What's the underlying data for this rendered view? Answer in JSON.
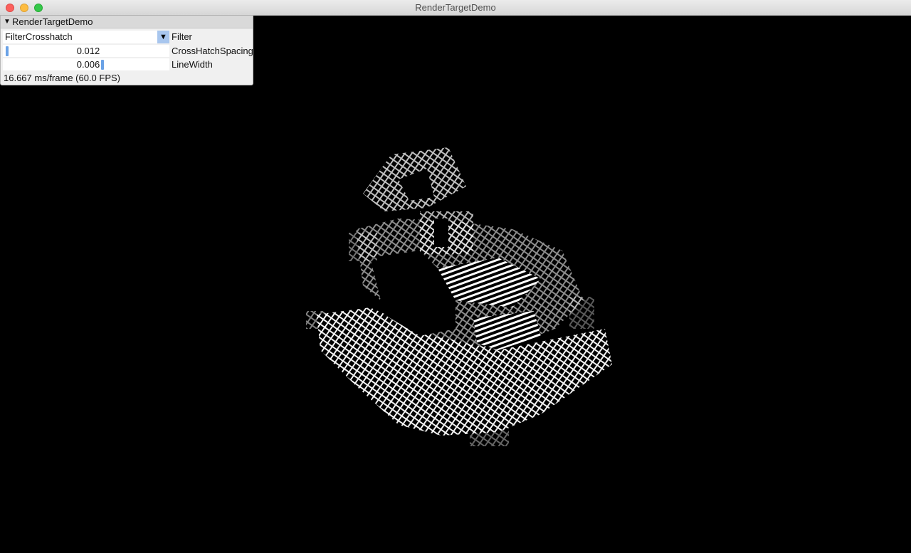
{
  "window": {
    "title": "RenderTargetDemo"
  },
  "panel": {
    "title": "RenderTargetDemo",
    "filter": {
      "value": "FilterCrosshatch",
      "label": "Filter"
    },
    "crosshatch_spacing": {
      "value": "0.012",
      "label": "CrossHatchSpacing",
      "level": 0.01
    },
    "line_width": {
      "value": "0.006",
      "label": "LineWidth",
      "level": 0.6
    },
    "fps_text": "16.667 ms/frame (60.0 FPS)"
  },
  "colors": {
    "background": "#000000",
    "panel_bg": "#f0f0f0",
    "accent": "#6aa2e6",
    "combo_button": "#a8c6ee"
  }
}
